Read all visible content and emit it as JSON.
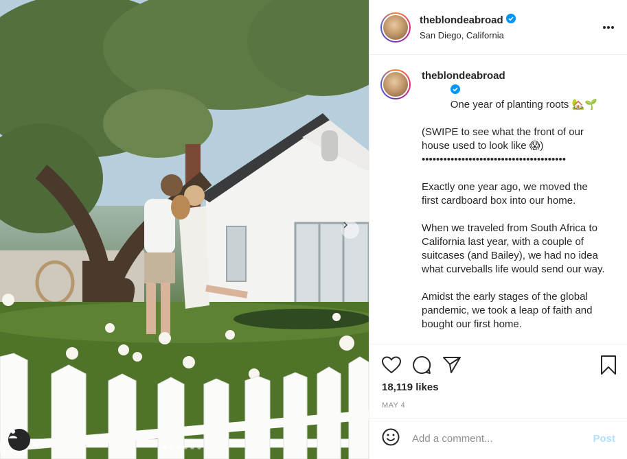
{
  "post": {
    "username": "theblondeabroad",
    "location": "San Diego, California",
    "caption_head": "One year of planting roots 🏡🌱",
    "caption_paragraphs": [
      "(SWIPE to see what the front of our house used to look like 😱)\n••••••••••••••••••••••••••••••••••••••••",
      "Exactly one year ago, we moved the first cardboard box into our home.",
      "When we traveled from South Africa to California last year, with a couple of suitcases (and Bailey), we had no idea what curveballs life would send our way.",
      "Amidst the early stages of the global pandemic, we took a leap of faith and bought our first home."
    ],
    "likes": "18,119 likes",
    "date": "MAY 4"
  },
  "comment": {
    "placeholder": "Add a comment...",
    "post_label": "Post"
  },
  "carousel": {
    "count": 6,
    "active_index": 0
  },
  "colors": {
    "verified": "#0095f6",
    "post_button": "#b2dffc",
    "muted": "#8e8e8e"
  },
  "icons": [
    "more-icon",
    "heart-icon",
    "comment-icon",
    "share-icon",
    "bookmark-icon",
    "emoji-icon",
    "user-tag-icon",
    "chevron-right-icon",
    "verified-icon"
  ]
}
